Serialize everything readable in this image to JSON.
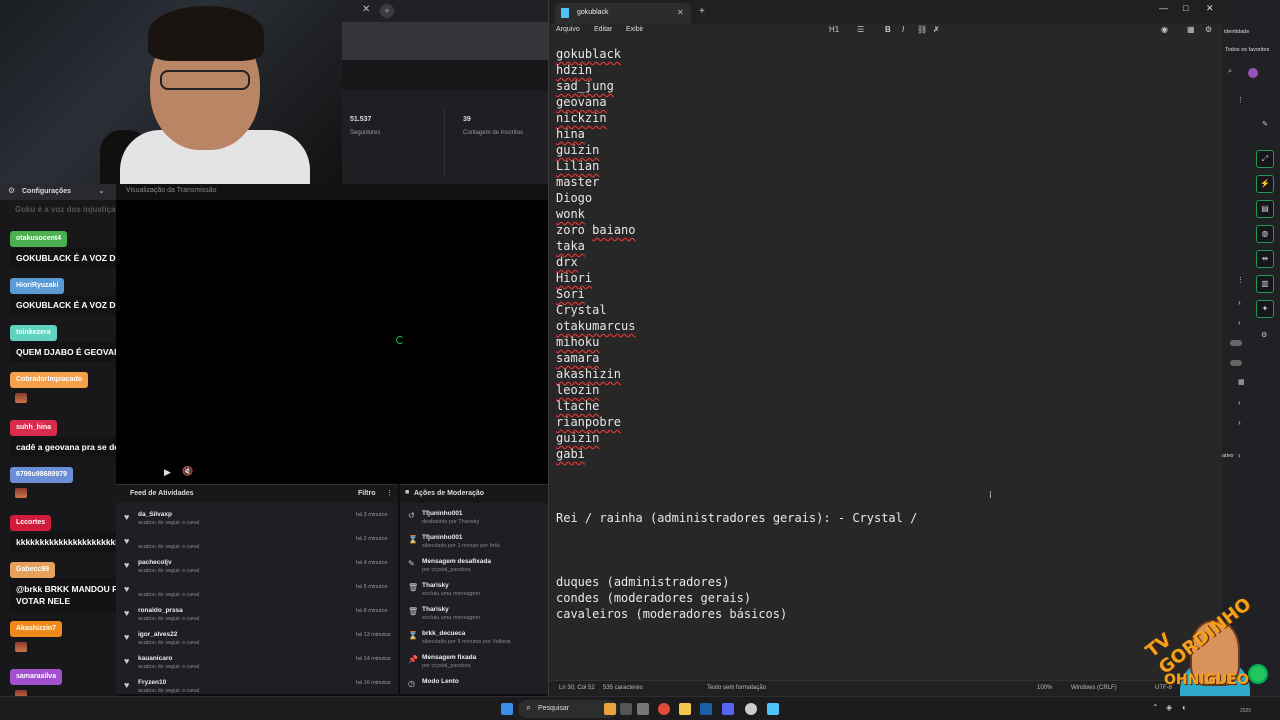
{
  "stats": {
    "followers_value": "51.537",
    "followers_label": "Seguidores",
    "subs_value": "39",
    "subs_label": "Contagem de Inscritos"
  },
  "chat": {
    "settings_label": "Configurações",
    "faded_text": "Goku é a voz dos injustiçados",
    "preview_header": "Visualização da Transmissão",
    "messages": [
      {
        "user": "otakusocent4",
        "text": "GOKUBLACK É A VOZ DOS HUMILHADOS",
        "color": "#4caf50"
      },
      {
        "user": "HioriRyuzaki",
        "text": "GOKUBLACK É A VOZ DOS HUMILHADOS",
        "color": "#5b9bd5"
      },
      {
        "user": "toinkezera",
        "text": "QUEM DJABO É GEOVANA?",
        "color": "#5fd3c0"
      },
      {
        "user": "CobradorImpiacado",
        "text": "",
        "color": "#f5a04a"
      },
      {
        "user": "suhh_hina",
        "text": "cadê a geovana pra se defende",
        "color": "#d92c4a"
      },
      {
        "user": "6799u98689979",
        "text": "",
        "color": "#6a8fd8"
      },
      {
        "user": "Lccortes",
        "text": "kkkkkkkkkkkkkkkkkkkkkkkkkkkkkkkkkkkkk",
        "color": "#d11b3a"
      },
      {
        "user": "Gabecc99",
        "text": "@brkk BRKK MANDOU FOTO DA BUNDA PRA TODO MUNDO VOTAR NELE",
        "color": "#e6a15a"
      },
      {
        "user": "Akashizzin7",
        "text": "",
        "color": "#f08a1c"
      },
      {
        "user": "samarasilva",
        "text": "",
        "color": "#a24fd0"
      }
    ]
  },
  "feed": {
    "title": "Feed de Atividades",
    "filter": "Filtro",
    "items": [
      {
        "name": "da_Silvaxp",
        "sub": "acabou de seguir o canal",
        "time": "há 3 minutos"
      },
      {
        "name": "",
        "sub": "acabou de seguir o canal",
        "time": "há 2 minutos"
      },
      {
        "name": "pachecoljv",
        "sub": "acabou de seguir o canal",
        "time": "há 4 minutos"
      },
      {
        "name": "",
        "sub": "acabou de seguir o canal",
        "time": "há 5 minutos"
      },
      {
        "name": "ronaldo_prssa",
        "sub": "acabou de seguir o canal",
        "time": "há 8 minutos"
      },
      {
        "name": "igor_alves22",
        "sub": "acabou de seguir o canal",
        "time": "há 13 minutos"
      },
      {
        "name": "kauanicaro",
        "sub": "acabou de seguir o canal",
        "time": "há 14 minutos"
      },
      {
        "name": "Fryzen10",
        "sub": "acabou de seguir o canal",
        "time": "há 16 minutos"
      }
    ]
  },
  "mod": {
    "title": "Ações de Moderação",
    "items": [
      {
        "name": "Tfjuninho001",
        "sub": "desbanido por Tharisky",
        "icon": "unban-icon"
      },
      {
        "name": "Tfjuninho001",
        "sub": "silenciado por 1 minuto por brkk",
        "icon": "timeout-icon"
      },
      {
        "name": "Mensagem desafixada",
        "sub": "por crystal_pandora",
        "icon": "unpin-icon"
      },
      {
        "name": "Tharisky",
        "sub": "excluiu uma mensagem",
        "icon": "trash-icon"
      },
      {
        "name": "Tharisky",
        "sub": "excluiu uma mensagem",
        "icon": "trash-icon"
      },
      {
        "name": "brkk_decueca",
        "sub": "silenciado por 5 minutos por Volbeat",
        "icon": "timeout-icon"
      },
      {
        "name": "Mensagem fixada",
        "sub": "por crystal_pandora",
        "icon": "pin-icon"
      },
      {
        "name": "Modo Lento",
        "sub": "",
        "icon": "slow-mode-icon"
      }
    ]
  },
  "notepad": {
    "tab_title": "gokublack",
    "menu": [
      "Arquivo",
      "Editar",
      "Exibir"
    ],
    "heading_selector": "H1",
    "content_lines": [
      "gokublack",
      "hdzin",
      "sad_jung",
      "geovana",
      "nickzin",
      "hina",
      "guizin",
      "Lilian",
      "master",
      "Diogo",
      "wonk",
      "zoro baiano",
      "taka",
      "drx",
      "Hiori",
      "Sori",
      "Crystal",
      "otakumarcus",
      "mihoku",
      "samara",
      "akashizin",
      "leozin",
      "ltache",
      "rianpobre",
      "guizin",
      "gabi",
      "",
      "",
      "",
      "Rei / rainha (administradores gerais): - Crystal /",
      "",
      "",
      "",
      "duques (administradores)",
      "condes (moderadores gerais)",
      "cavaleiros (moderadores básicos)"
    ],
    "status": {
      "position": "Ln 30, Col 52",
      "chars": "535 caracteres",
      "format": "Texto sem formatação",
      "zoom": "100%",
      "line_ending": "Windows (CRLF)",
      "encoding": "UTF-8"
    }
  },
  "right_panel": {
    "identity": "identidade",
    "favorites": "Todos os favoritos",
    "active": "ativo"
  },
  "overlay": {
    "top_text": "TV GORDINHO",
    "bottom_text": "OHNIGUEO"
  },
  "taskbar": {
    "search_placeholder": "Pesquisar",
    "date": "2025"
  }
}
